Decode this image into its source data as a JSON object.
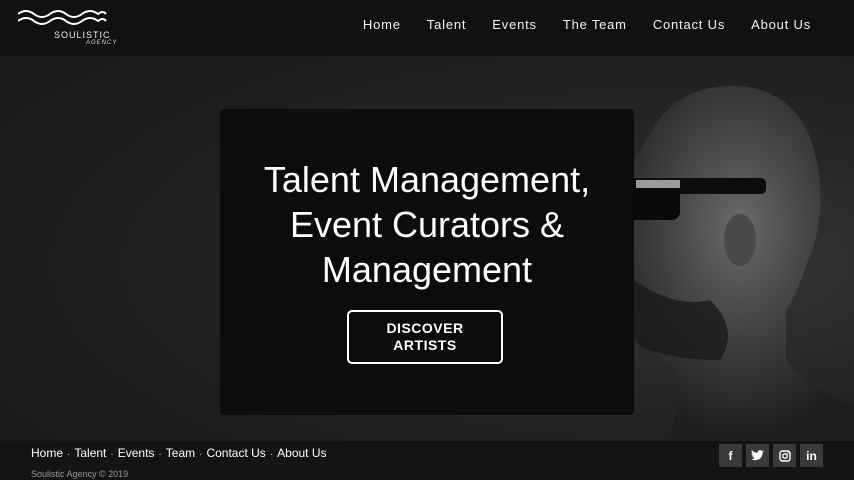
{
  "brand": {
    "name": "SOULISTIC",
    "sub": "AGENCY"
  },
  "nav": [
    "Home",
    "Talent",
    "Events",
    "The Team",
    "Contact Us",
    "About Us"
  ],
  "hero": {
    "lines": [
      "Talent Management,",
      "Event Curators &",
      "Management"
    ],
    "cta_line1": "DISCOVER",
    "cta_line2": "ARTISTS"
  },
  "footer": {
    "links": [
      "Home",
      "Talent",
      "Events",
      "Team",
      "Contact Us",
      "About Us"
    ],
    "separator": "·",
    "copyright": "Soulistic Agency © 2019",
    "social": [
      {
        "icon": "facebook-icon",
        "glyph": "f"
      },
      {
        "icon": "twitter-icon",
        "glyph": "t"
      },
      {
        "icon": "instagram-icon",
        "glyph": "◎"
      },
      {
        "icon": "linkedin-icon",
        "glyph": "in"
      }
    ]
  },
  "colors": {
    "header_bg": "#111111",
    "card_bg": "#0c0c0c",
    "footer_bg": "#141414",
    "text": "#ffffff"
  }
}
